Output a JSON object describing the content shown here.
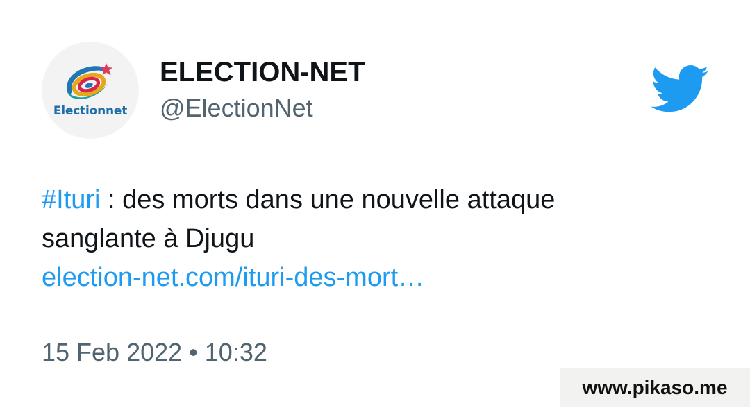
{
  "author": {
    "display_name": "ELECTION-NET",
    "handle": "@ElectionNet",
    "avatar_text": "Electionnet"
  },
  "tweet": {
    "hashtag": "#Ituri",
    "text_after_hashtag": " : des morts dans une nouvelle attaque",
    "text_line2": "sanglante à Djugu",
    "link": "election-net.com/ituri-des-mort…",
    "timestamp": "15 Feb 2022 • 10:32"
  },
  "watermark": "www.pikaso.me",
  "colors": {
    "link": "#1d9bf0",
    "twitter_blue": "#1d9bf0",
    "text": "#0f1419",
    "secondary": "#536471"
  },
  "icons": {
    "brand": "twitter-bird-icon",
    "avatar": "electionnet-logo"
  }
}
